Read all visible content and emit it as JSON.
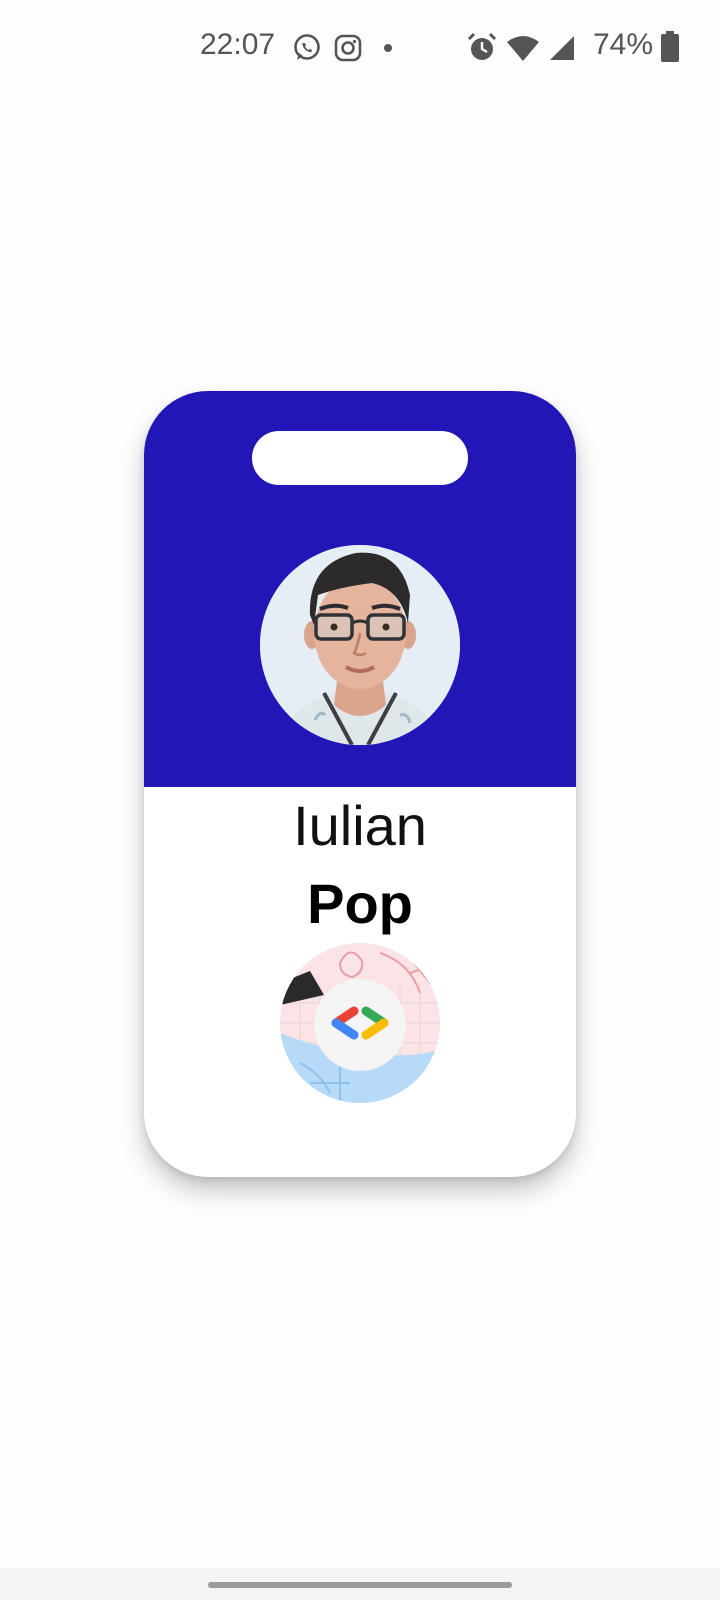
{
  "status_bar": {
    "time": "22:07",
    "battery_percent": "74%",
    "notification_icons": [
      "whatsapp-icon",
      "instagram-icon",
      "more-dot-icon"
    ],
    "system_icons": [
      "alarm-icon",
      "wifi-icon",
      "cellular-signal-icon",
      "battery-icon"
    ]
  },
  "badge": {
    "header_color": "#2217b6",
    "first_name": "Iulian",
    "last_name": "Pop",
    "avatar": "profile-photo",
    "logo": "google-developers-logo"
  },
  "colors": {
    "badge_blue": "#2217b6",
    "logo_blue": "#4285f4",
    "logo_red": "#ea4335",
    "logo_green": "#34a853",
    "logo_yellow": "#fbbc04"
  }
}
